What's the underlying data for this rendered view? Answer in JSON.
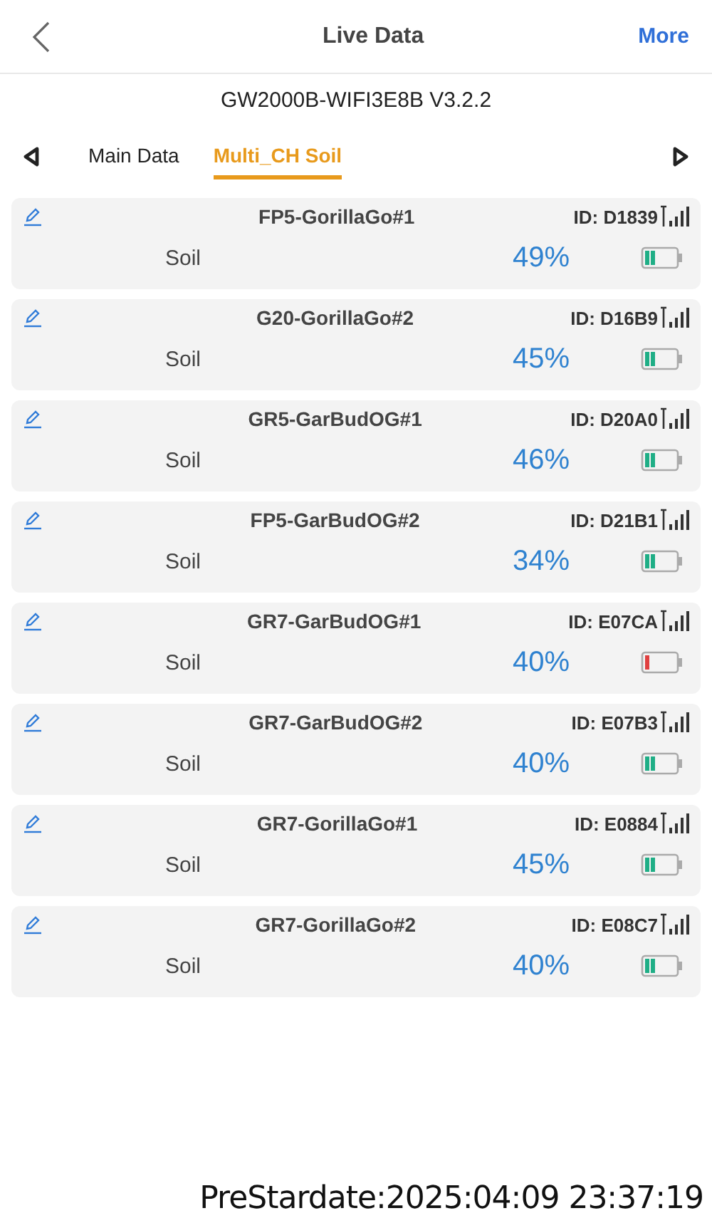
{
  "header": {
    "title": "Live Data",
    "action": "More"
  },
  "device": "GW2000B-WIFI3E8B V3.2.2",
  "tabs": [
    {
      "label": "Main Data",
      "selected": false
    },
    {
      "label": "Multi_CH Soil",
      "selected": true
    }
  ],
  "sensors": [
    {
      "name": "FP5-GorillaGo#1",
      "id": "ID: D1839",
      "label": "Soil",
      "value": "49%",
      "battery_low": false
    },
    {
      "name": "G20-GorillaGo#2",
      "id": "ID: D16B9",
      "label": "Soil",
      "value": "45%",
      "battery_low": false
    },
    {
      "name": "GR5-GarBudOG#1",
      "id": "ID: D20A0",
      "label": "Soil",
      "value": "46%",
      "battery_low": false
    },
    {
      "name": "FP5-GarBudOG#2",
      "id": "ID: D21B1",
      "label": "Soil",
      "value": "34%",
      "battery_low": false
    },
    {
      "name": "GR7-GarBudOG#1",
      "id": "ID: E07CA",
      "label": "Soil",
      "value": "40%",
      "battery_low": true
    },
    {
      "name": "GR7-GarBudOG#2",
      "id": "ID: E07B3",
      "label": "Soil",
      "value": "40%",
      "battery_low": false
    },
    {
      "name": "GR7-GorillaGo#1",
      "id": "ID: E0884",
      "label": "Soil",
      "value": "45%",
      "battery_low": false
    },
    {
      "name": "GR7-GorillaGo#2",
      "id": "ID: E08C7",
      "label": "Soil",
      "value": "40%",
      "battery_low": false
    }
  ],
  "footer": "PreStardate:2025:04:09 23:37:19"
}
